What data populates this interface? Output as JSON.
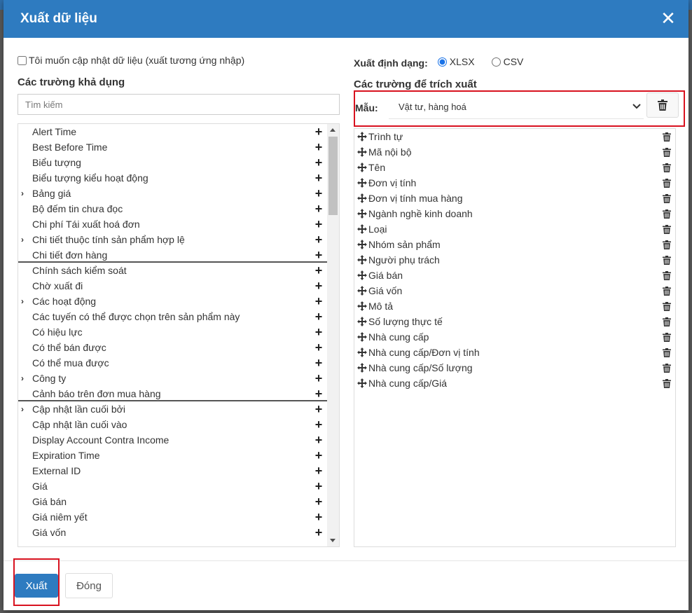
{
  "dialog": {
    "title": "Xuất dữ liệu",
    "close_icon": "close-x-icon"
  },
  "left": {
    "update_checkbox_label": "Tôi muốn cập nhật dữ liệu (xuất tương ứng nhập)",
    "update_checkbox_checked": false,
    "section_title": "Các trường khả dụng",
    "search_placeholder": "Tìm kiếm",
    "fields": [
      {
        "label": "Alert Time",
        "expandable": false
      },
      {
        "label": "Best Before Time",
        "expandable": false
      },
      {
        "label": "Biểu tượng",
        "expandable": false
      },
      {
        "label": "Biểu tượng kiểu hoạt động",
        "expandable": false
      },
      {
        "label": "Bảng giá",
        "expandable": true
      },
      {
        "label": "Bộ đếm tin chưa đọc",
        "expandable": false
      },
      {
        "label": "Chi phí Tái xuất hoá đơn",
        "expandable": false
      },
      {
        "label": "Chi tiết thuộc tính sản phẩm hợp lệ",
        "expandable": true
      },
      {
        "label": "Chi tiết đơn hàng",
        "expandable": false,
        "separator": true
      },
      {
        "label": "Chính sách kiểm soát",
        "expandable": false
      },
      {
        "label": "Chờ xuất đi",
        "expandable": false
      },
      {
        "label": "Các hoạt động",
        "expandable": true
      },
      {
        "label": "Các tuyến có thể được chọn trên sản phẩm này",
        "expandable": false
      },
      {
        "label": "Có hiệu lực",
        "expandable": false
      },
      {
        "label": "Có thể bán được",
        "expandable": false
      },
      {
        "label": "Có thể mua được",
        "expandable": false
      },
      {
        "label": "Công ty",
        "expandable": true
      },
      {
        "label": "Cảnh báo trên đơn mua hàng",
        "expandable": false,
        "separator": true
      },
      {
        "label": "Cập nhật lần cuối bởi",
        "expandable": true
      },
      {
        "label": "Cập nhật lần cuối vào",
        "expandable": false
      },
      {
        "label": "Display Account Contra Income",
        "expandable": false
      },
      {
        "label": "Expiration Time",
        "expandable": false
      },
      {
        "label": "External ID",
        "expandable": false
      },
      {
        "label": "Giá",
        "expandable": false
      },
      {
        "label": "Giá bán",
        "expandable": false
      },
      {
        "label": "Giá niêm yết",
        "expandable": false
      },
      {
        "label": "Giá vốn",
        "expandable": false
      }
    ]
  },
  "right": {
    "format_label": "Xuất định dạng:",
    "formats": [
      {
        "label": "XLSX",
        "selected": true
      },
      {
        "label": "CSV",
        "selected": false
      }
    ],
    "section_title": "Các trường để trích xuất",
    "template_label": "Mẫu:",
    "template_value": "Vật tư, hàng hoá",
    "selected_fields": [
      "Trình tự",
      "Mã nội bộ",
      "Tên",
      "Đơn vị tính",
      "Đơn vị tính mua hàng",
      "Ngành nghề kinh doanh",
      "Loại",
      "Nhóm sản phẩm",
      "Người phụ trách",
      "Giá bán",
      "Giá vốn",
      "Mô tả",
      "Số lượng thực tế",
      "Nhà cung cấp",
      "Nhà cung cấp/Đơn vị tính",
      "Nhà cung cấp/Số lượng",
      "Nhà cung cấp/Giá"
    ]
  },
  "footer": {
    "export_label": "Xuất",
    "close_label": "Đóng"
  },
  "colors": {
    "header_bg": "#2e7bc0",
    "primary_button": "#2e7bc0",
    "highlight": "#d8121f"
  }
}
